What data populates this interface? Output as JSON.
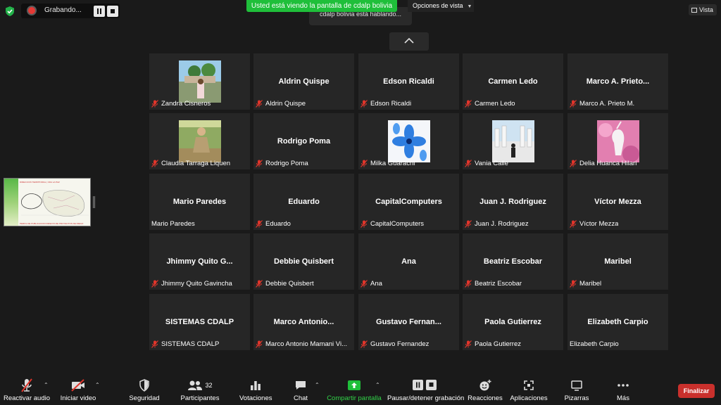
{
  "top": {
    "recording_label": "Grabando...",
    "share_banner": "Usted está viendo la pantalla de cdalp bolivia",
    "speaking_text": "cdalp bolivia está hablando...",
    "view_options": "Opciones de vista",
    "vista_label": "Vista"
  },
  "thumbnail": {
    "title": "DIRECCION TERRITORIAL | CDA LA PAZ",
    "subtitle": "PERFIL DE PUBLICACION DIRECTA DE PROYECTOS DE RIEGO"
  },
  "participants": [
    {
      "tile_name": "",
      "label": "Zandra Cisneros",
      "muted": true,
      "photo": "zandra"
    },
    {
      "tile_name": "Aldrin Quispe",
      "label": "Aldrin Quispe",
      "muted": true
    },
    {
      "tile_name": "Edson Ricaldi",
      "label": "Edson Ricaldi",
      "muted": true
    },
    {
      "tile_name": "Carmen Ledo",
      "label": "Carmen Ledo",
      "muted": true
    },
    {
      "tile_name": "Marco A. Prieto...",
      "label": "Marco A. Prieto M.",
      "muted": true
    },
    {
      "tile_name": "",
      "label": "Claudia Tarraga Liquen",
      "muted": true,
      "photo": "claudia"
    },
    {
      "tile_name": "Rodrigo Poma",
      "label": "Rodrigo Poma",
      "muted": true
    },
    {
      "tile_name": "",
      "label": "Milka Guarachi",
      "muted": true,
      "photo": "milka"
    },
    {
      "tile_name": "",
      "label": "Vania Calle",
      "muted": true,
      "photo": "vania"
    },
    {
      "tile_name": "",
      "label": "Delia Huanca Hilari",
      "muted": true,
      "photo": "delia"
    },
    {
      "tile_name": "Mario Paredes",
      "label": "Mario Paredes",
      "muted": false
    },
    {
      "tile_name": "Eduardo",
      "label": "Eduardo",
      "muted": true
    },
    {
      "tile_name": "CapitalComputers",
      "label": "CapitalComputers",
      "muted": true
    },
    {
      "tile_name": "Juan J. Rodriguez",
      "label": "Juan J. Rodriguez",
      "muted": true
    },
    {
      "tile_name": "Víctor Mezza",
      "label": "Víctor Mezza",
      "muted": true
    },
    {
      "tile_name": "Jhimmy Quito G...",
      "label": "Jhimmy Quito Gavincha",
      "muted": true
    },
    {
      "tile_name": "Debbie Quisbert",
      "label": "Debbie Quisbert",
      "muted": true
    },
    {
      "tile_name": "Ana",
      "label": "Ana",
      "muted": true
    },
    {
      "tile_name": "Beatriz Escobar",
      "label": "Beatriz Escobar",
      "muted": true
    },
    {
      "tile_name": "Maribel",
      "label": "Maribel",
      "muted": true
    },
    {
      "tile_name": "SISTEMAS CDALP",
      "label": "SISTEMAS CDALP",
      "muted": true
    },
    {
      "tile_name": "Marco Antonio...",
      "label": "Marco Antonio Mamani Vi...",
      "muted": true
    },
    {
      "tile_name": "Gustavo Fernan...",
      "label": "Gustavo Fernandez",
      "muted": true
    },
    {
      "tile_name": "Paola Gutierrez",
      "label": "Paola Gutierrez",
      "muted": true
    },
    {
      "tile_name": "Elizabeth Carpio",
      "label": "Elizabeth Carpio",
      "muted": false
    }
  ],
  "toolbar": {
    "audio": "Reactivar audio",
    "video": "Iniciar video",
    "security": "Seguridad",
    "participants": "Participantes",
    "participants_count": "32",
    "polls": "Votaciones",
    "chat": "Chat",
    "share": "Compartir pantalla",
    "record": "Pausar/detener grabación",
    "reactions": "Reacciones",
    "apps": "Aplicaciones",
    "whiteboards": "Pizarras",
    "more": "Más",
    "end": "Finalizar"
  },
  "colors": {
    "share_green": "#1fbf3a",
    "end_red": "#c9302c",
    "muted_red": "#e0352b"
  }
}
